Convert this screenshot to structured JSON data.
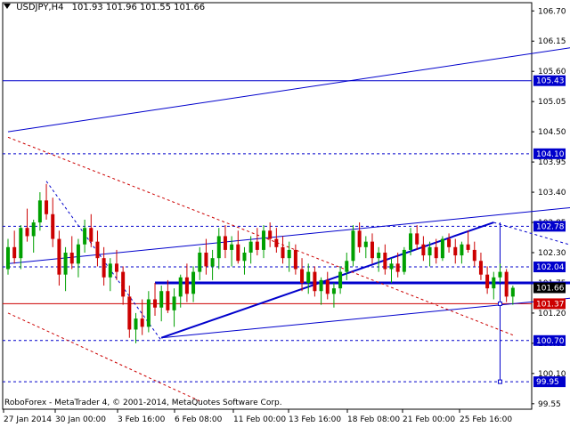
{
  "header": {
    "symbol": "USDJPY,H4",
    "ohlc": "101.93 101.96 101.55 101.66"
  },
  "copyright": "RoboForex - MetaTrader 4, © 2001-2014, MetaQuotes Software Corp.",
  "colors": {
    "axis": "#000000",
    "candle_up": "#00a000",
    "candle_down": "#cc0000",
    "trend_blue": "#0000cc",
    "trend_red": "#cc0000",
    "label_blue_bg": "#0000cc",
    "label_red_bg": "#cc0000",
    "label_text": "#ffffff",
    "grid": "#000000"
  },
  "chart_data": {
    "type": "candlestick",
    "y_ticks": [
      "106.70",
      "106.15",
      "105.60",
      "105.05",
      "104.50",
      "103.95",
      "103.40",
      "102.85",
      "102.30",
      "101.75",
      "101.20",
      "100.65",
      "100.10",
      "99.55"
    ],
    "x_ticks": [
      "27 Jan 2014",
      "30 Jan 00:00",
      "3 Feb 16:00",
      "6 Feb 08:00",
      "11 Feb 00:00",
      "13 Feb 16:00",
      "18 Feb 08:00",
      "21 Feb 00:00",
      "25 Feb 16:00"
    ],
    "ylim": [
      99.45,
      106.85
    ],
    "price_labels": [
      {
        "value": 106.15,
        "text": "",
        "kind": "none"
      },
      {
        "value": 105.43,
        "text": "105.43",
        "kind": "blue"
      },
      {
        "value": 104.1,
        "text": "104.10",
        "kind": "blue"
      },
      {
        "value": 102.78,
        "text": "102.78",
        "kind": "blue"
      },
      {
        "value": 102.04,
        "text": "102.04",
        "kind": "blue"
      },
      {
        "value": 101.66,
        "text": "101.66",
        "kind": "black"
      },
      {
        "value": 101.37,
        "text": "101.37",
        "kind": "red"
      },
      {
        "value": 100.7,
        "text": "100.70",
        "kind": "blue"
      },
      {
        "value": 99.95,
        "text": "99.95",
        "kind": "blue"
      }
    ],
    "levels": [
      {
        "name": "solid-105.43",
        "value": 105.43,
        "style": "solid",
        "color": "blue"
      },
      {
        "name": "dashed-104.10",
        "value": 104.1,
        "style": "dashed",
        "color": "blue"
      },
      {
        "name": "dashed-102.78",
        "value": 102.78,
        "style": "dashed",
        "color": "blue"
      },
      {
        "name": "dashed-102.04",
        "value": 102.04,
        "style": "dashed",
        "color": "blue"
      },
      {
        "name": "solid-101.37",
        "value": 101.37,
        "style": "solid",
        "color": "red"
      },
      {
        "name": "dashed-100.70",
        "value": 100.7,
        "style": "dashed",
        "color": "blue"
      },
      {
        "name": "dashed-99.95",
        "value": 99.95,
        "style": "dashed",
        "color": "blue"
      }
    ],
    "candles": [
      [
        102.0,
        102.55,
        101.9,
        102.4
      ],
      [
        102.4,
        102.7,
        102.1,
        102.2
      ],
      [
        102.2,
        102.8,
        102.0,
        102.75
      ],
      [
        102.75,
        103.1,
        102.5,
        102.6
      ],
      [
        102.6,
        102.9,
        102.3,
        102.85
      ],
      [
        102.85,
        103.4,
        102.7,
        103.25
      ],
      [
        103.25,
        103.55,
        102.9,
        103.0
      ],
      [
        103.0,
        103.3,
        102.4,
        102.55
      ],
      [
        102.55,
        102.7,
        101.7,
        101.9
      ],
      [
        101.9,
        102.4,
        101.6,
        102.3
      ],
      [
        102.3,
        102.6,
        102.0,
        102.1
      ],
      [
        102.1,
        102.55,
        101.85,
        102.45
      ],
      [
        102.45,
        102.9,
        102.3,
        102.75
      ],
      [
        102.75,
        103.0,
        102.4,
        102.5
      ],
      [
        102.5,
        102.7,
        102.05,
        102.2
      ],
      [
        102.2,
        102.4,
        101.7,
        101.85
      ],
      [
        101.85,
        102.2,
        101.6,
        102.1
      ],
      [
        102.1,
        102.35,
        101.8,
        101.95
      ],
      [
        101.95,
        102.05,
        101.35,
        101.5
      ],
      [
        101.5,
        101.7,
        100.75,
        100.9
      ],
      [
        100.9,
        101.2,
        100.65,
        101.1
      ],
      [
        101.1,
        101.45,
        100.8,
        100.95
      ],
      [
        100.95,
        101.6,
        100.85,
        101.45
      ],
      [
        101.45,
        101.75,
        101.15,
        101.3
      ],
      [
        101.3,
        101.7,
        101.05,
        101.6
      ],
      [
        101.6,
        101.8,
        101.2,
        101.25
      ],
      [
        101.25,
        101.65,
        100.95,
        101.5
      ],
      [
        101.5,
        101.9,
        101.3,
        101.85
      ],
      [
        101.85,
        102.1,
        101.4,
        101.55
      ],
      [
        101.55,
        102.05,
        101.4,
        101.95
      ],
      [
        101.95,
        102.4,
        101.8,
        102.3
      ],
      [
        102.3,
        102.55,
        101.9,
        102.05
      ],
      [
        102.05,
        102.35,
        101.8,
        102.2
      ],
      [
        102.2,
        102.75,
        102.0,
        102.6
      ],
      [
        102.6,
        102.8,
        102.2,
        102.35
      ],
      [
        102.35,
        102.6,
        102.05,
        102.45
      ],
      [
        102.45,
        102.7,
        102.1,
        102.15
      ],
      [
        102.15,
        102.4,
        101.9,
        102.3
      ],
      [
        102.3,
        102.6,
        102.1,
        102.5
      ],
      [
        102.5,
        102.75,
        102.25,
        102.35
      ],
      [
        102.35,
        102.8,
        102.2,
        102.7
      ],
      [
        102.7,
        102.85,
        102.4,
        102.55
      ],
      [
        102.55,
        102.75,
        102.3,
        102.4
      ],
      [
        102.4,
        102.6,
        102.1,
        102.2
      ],
      [
        102.2,
        102.5,
        101.95,
        102.35
      ],
      [
        102.35,
        102.45,
        101.9,
        102.0
      ],
      [
        102.0,
        102.2,
        101.6,
        101.75
      ],
      [
        101.75,
        102.1,
        101.55,
        101.95
      ],
      [
        101.95,
        102.05,
        101.5,
        101.6
      ],
      [
        101.6,
        101.85,
        101.35,
        101.8
      ],
      [
        101.8,
        101.95,
        101.45,
        101.55
      ],
      [
        101.55,
        101.75,
        101.3,
        101.65
      ],
      [
        101.65,
        102.05,
        101.55,
        101.95
      ],
      [
        101.95,
        102.3,
        101.8,
        102.15
      ],
      [
        102.15,
        102.8,
        102.05,
        102.7
      ],
      [
        102.7,
        102.85,
        102.3,
        102.4
      ],
      [
        102.4,
        102.6,
        102.2,
        102.5
      ],
      [
        102.5,
        102.65,
        102.1,
        102.2
      ],
      [
        102.2,
        102.4,
        101.95,
        102.3
      ],
      [
        102.3,
        102.45,
        101.9,
        102.0
      ],
      [
        102.0,
        102.2,
        101.75,
        102.1
      ],
      [
        102.1,
        102.3,
        101.85,
        101.95
      ],
      [
        101.95,
        102.4,
        101.9,
        102.35
      ],
      [
        102.35,
        102.75,
        102.25,
        102.65
      ],
      [
        102.65,
        102.8,
        102.35,
        102.45
      ],
      [
        102.45,
        102.6,
        102.15,
        102.25
      ],
      [
        102.25,
        102.5,
        102.05,
        102.4
      ],
      [
        102.4,
        102.55,
        102.1,
        102.2
      ],
      [
        102.2,
        102.6,
        102.15,
        102.55
      ],
      [
        102.55,
        102.65,
        102.3,
        102.4
      ],
      [
        102.4,
        102.55,
        102.1,
        102.25
      ],
      [
        102.25,
        102.5,
        102.1,
        102.45
      ],
      [
        102.45,
        102.7,
        102.3,
        102.35
      ],
      [
        102.35,
        102.5,
        102.05,
        102.15
      ],
      [
        102.15,
        102.3,
        101.8,
        101.9
      ],
      [
        101.9,
        102.05,
        101.55,
        101.65
      ],
      [
        101.65,
        101.95,
        101.45,
        101.85
      ],
      [
        101.85,
        102.1,
        101.75,
        101.95
      ],
      [
        101.95,
        102.0,
        101.4,
        101.5
      ],
      [
        101.5,
        101.7,
        101.35,
        101.66
      ]
    ],
    "trend_lines": [
      {
        "name": "upper-channel-line",
        "color": "blue",
        "style": "solid",
        "p1": [
          0,
          104.5
        ],
        "p2": [
          95,
          106.15
        ]
      },
      {
        "name": "channel-top-line",
        "color": "blue",
        "style": "solid",
        "p1": [
          0,
          102.1
        ],
        "p2": [
          95,
          103.2
        ]
      },
      {
        "name": "channel-bottom-line",
        "color": "blue",
        "style": "solid",
        "p1": [
          24,
          100.75
        ],
        "p2": [
          95,
          101.55
        ]
      },
      {
        "name": "rising-wave-line",
        "color": "blue",
        "style": "solid",
        "width": 2,
        "p1": [
          24,
          100.75
        ],
        "p2": [
          76,
          102.85
        ]
      },
      {
        "name": "resistance-bar",
        "color": "blue",
        "style": "solid",
        "width": 3,
        "p1": [
          23,
          101.75
        ],
        "p2": [
          98,
          101.75
        ]
      },
      {
        "name": "red-descending-line",
        "color": "red",
        "style": "dashed",
        "p1": [
          0,
          104.4
        ],
        "p2": [
          79,
          100.8
        ]
      },
      {
        "name": "red-lower-line",
        "color": "red",
        "style": "dashed",
        "p1": [
          0,
          101.2
        ],
        "p2": [
          30,
          99.6
        ]
      },
      {
        "name": "blue-dashed-down",
        "color": "blue",
        "style": "dashed",
        "p1": [
          6,
          103.6
        ],
        "p2": [
          24,
          100.7
        ]
      },
      {
        "name": "target-vertical",
        "color": "blue",
        "style": "solid",
        "p1": [
          77,
          102.85
        ],
        "p2": [
          77,
          99.95
        ]
      },
      {
        "name": "target-dashed-right",
        "color": "blue",
        "style": "dashed",
        "p1": [
          76,
          102.85
        ],
        "p2": [
          98,
          102.1
        ]
      }
    ],
    "arrow": {
      "x": 96,
      "value": 101.3,
      "direction": "down"
    }
  }
}
